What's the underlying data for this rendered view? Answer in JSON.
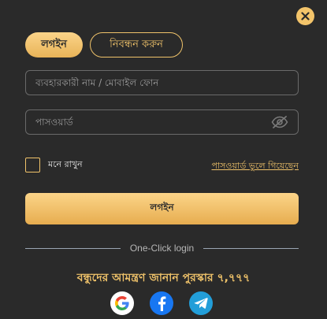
{
  "colors": {
    "background": "#2a2a2a",
    "accent": "#f0c36a",
    "button_gradient_top": "#fbd489",
    "button_gradient_bottom": "#e7ad4f"
  },
  "close": {
    "icon": "close-icon"
  },
  "tabs": [
    {
      "label": "লগইন",
      "active": true
    },
    {
      "label": "নিবন্ধন করুন",
      "active": false
    }
  ],
  "username": {
    "placeholder": "ব্যবহারকারী নাম / মোবাইল ফোন",
    "value": ""
  },
  "password": {
    "placeholder": "পাসওয়ার্ড",
    "value": "",
    "toggle_icon": "eye-off-icon"
  },
  "remember": {
    "label": "মনে রাখুন",
    "checked": false
  },
  "forgot": {
    "label": "পাসওয়ার্ড ভুলে গিয়েছেন"
  },
  "login_button": {
    "label": "লগইন"
  },
  "divider": {
    "label": "One-Click login"
  },
  "referral": {
    "text": "বন্ধুদের আমন্ত্রণ জানান পুরস্কার ৭,৭৭৭"
  },
  "social": [
    {
      "name": "google",
      "icon": "google-icon"
    },
    {
      "name": "facebook",
      "icon": "facebook-icon"
    },
    {
      "name": "telegram",
      "icon": "telegram-icon"
    }
  ]
}
